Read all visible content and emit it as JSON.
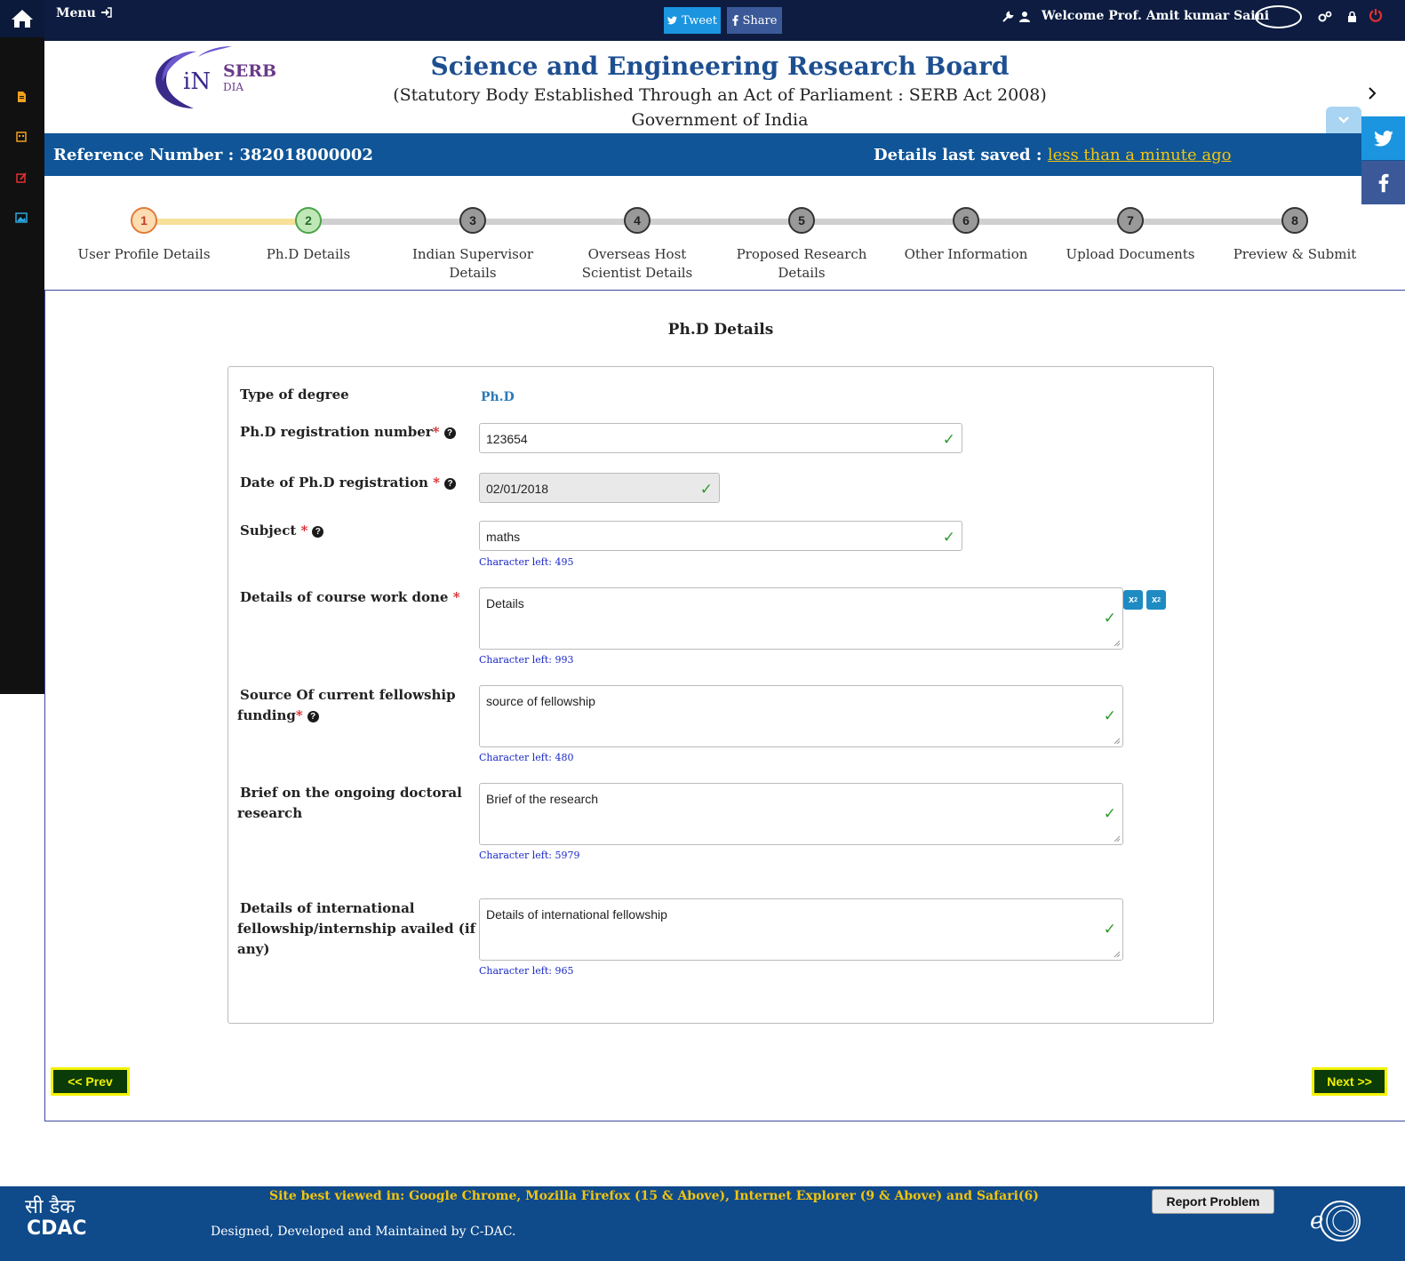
{
  "topbar": {
    "menu_label": "Menu",
    "tweet_label": "Tweet",
    "share_label": "Share",
    "welcome_text": "Welcome Prof. Amit kumar Saini"
  },
  "header": {
    "title": "Science and Engineering Research Board",
    "subtitle": "(Statutory Body Established Through an Act of Parliament : SERB Act 2008)",
    "subtitle2": "Government of India",
    "logo_main": "SERB",
    "logo_sub": "DIA",
    "logo_letters": "iN"
  },
  "refbar": {
    "reference_label": "Reference Number : 382018000002",
    "last_saved_label": "Details last saved :",
    "last_saved_value": "less than a minute ago"
  },
  "steps": [
    {
      "number": "1",
      "label": "User Profile Details",
      "status": "active"
    },
    {
      "number": "2",
      "label": "Ph.D Details",
      "status": "current"
    },
    {
      "number": "3",
      "label": "Indian Supervisor Details",
      "status": "pending"
    },
    {
      "number": "4",
      "label": "Overseas Host Scientist Details",
      "status": "pending"
    },
    {
      "number": "5",
      "label": "Proposed Research Details",
      "status": "pending"
    },
    {
      "number": "6",
      "label": "Other Information",
      "status": "pending"
    },
    {
      "number": "7",
      "label": "Upload Documents",
      "status": "pending"
    },
    {
      "number": "8",
      "label": "Preview & Submit",
      "status": "pending"
    }
  ],
  "form": {
    "section_title": "Ph.D Details",
    "degree_type_label": "Type of degree",
    "degree_type_value": "Ph.D",
    "reg_number_label": "Ph.D registration number",
    "reg_number_value": "123654",
    "reg_date_label": "Date of Ph.D registration",
    "reg_date_value": "02/01/2018",
    "subject_label": "Subject",
    "subject_value": "maths",
    "subject_chars": "Character left: 495",
    "course_label": "Details of course work done",
    "course_value": "Details",
    "course_chars": "Character left: 993",
    "funding_label_1": "Source Of current fellowship",
    "funding_label_2": "funding",
    "funding_value": "source of fellowship",
    "funding_chars": "Character left: 480",
    "brief_label_1": "Brief on the ongoing doctoral",
    "brief_label_2": "research",
    "brief_value": "Brief of the research",
    "brief_chars": "Character left: 5979",
    "intl_label_1": "Details of international",
    "intl_label_2": "fellowship/internship availed (if",
    "intl_label_3": "any)",
    "intl_value": "Details of international fellowship",
    "intl_chars": "Character left: 965",
    "required_mark": "*",
    "help_mark": "?",
    "check_mark": "✓"
  },
  "nav": {
    "prev_label": "<< Prev",
    "next_label": "Next >>"
  },
  "footer": {
    "best_viewed": "Site best viewed in: Google Chrome, Mozilla Firefox (15 & Above), Internet Explorer (9 & Above) and Safari(6)",
    "designed_by": "Designed, Developed and Maintained by C-DAC.",
    "report_label": "Report Problem",
    "cdac_hindi": "सी डैक",
    "cdac_text": "CDAC",
    "eppms_text": "e"
  },
  "colors": {
    "navbar": "#0d1c40",
    "refbar": "#0f5597",
    "title": "#1d4f91",
    "footer": "#0f4a8a",
    "accent_yellow": "#f2f200"
  }
}
